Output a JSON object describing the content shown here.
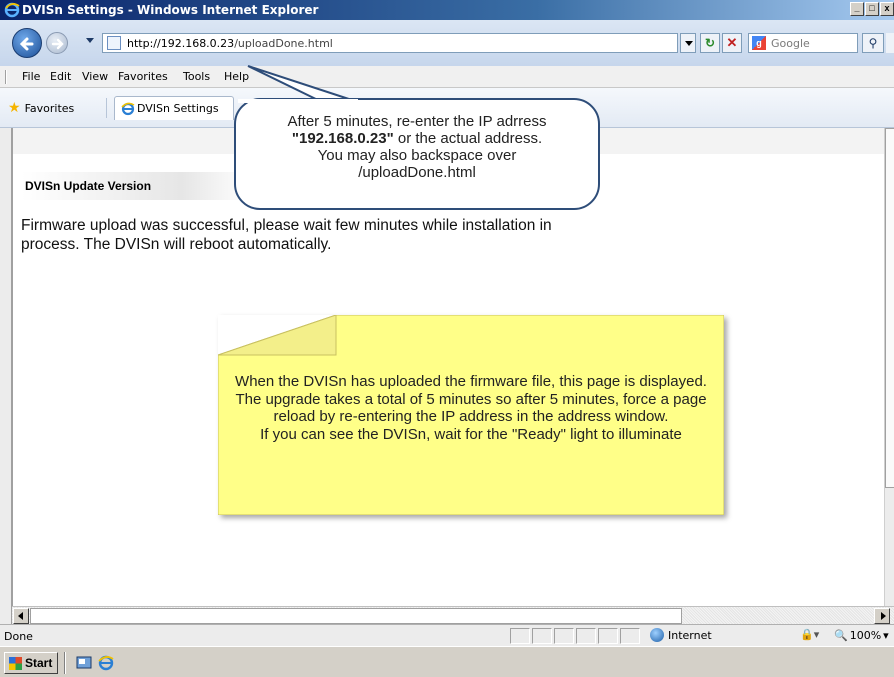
{
  "window": {
    "title": "DVISn Settings - Windows Internet Explorer",
    "min_glyph": "_",
    "max_glyph": "□",
    "close_glyph": "x"
  },
  "nav": {
    "url_host": "http://192.168.0.23",
    "url_path": "/uploadDone.html",
    "search_placeholder": "Google"
  },
  "menu": {
    "items": [
      "File",
      "Edit",
      "View",
      "Favorites",
      "Tools",
      "Help"
    ]
  },
  "favorites_bar": {
    "favorites_label": "Favorites",
    "tab_label": "DVISn Settings"
  },
  "page": {
    "heading": "DVISn Update Version",
    "message": "Firmware upload was successful, please wait few minutes while installation in process. The DVISn will reboot automatically."
  },
  "callout_bubble": {
    "line1": "After 5 minutes, re-enter the IP adrress",
    "ip": "\"192.168.0.23\"",
    "line2_rest": " or the actual address.",
    "line3": "You may also backspace over",
    "line4": "/uploadDone.html"
  },
  "callout_note": {
    "line1": "When the DVISn has uploaded the firmware file, this page is displayed.",
    "line2": "The upgrade takes a total of 5 minutes so after 5 minutes, force a page reload by re-entering the IP address in the address window.",
    "line3": "If you can see the DVISn, wait for the \"Ready\" light to illuminate",
    "fill_color": "#ffff88",
    "border_color": "#c8c060"
  },
  "status": {
    "text": "Done",
    "zone": "Internet",
    "zoom": "100%"
  },
  "taskbar": {
    "start_label": "Start"
  },
  "colors": {
    "titlebar_start": "#0a246a",
    "bubble_border": "#2e4d79"
  }
}
